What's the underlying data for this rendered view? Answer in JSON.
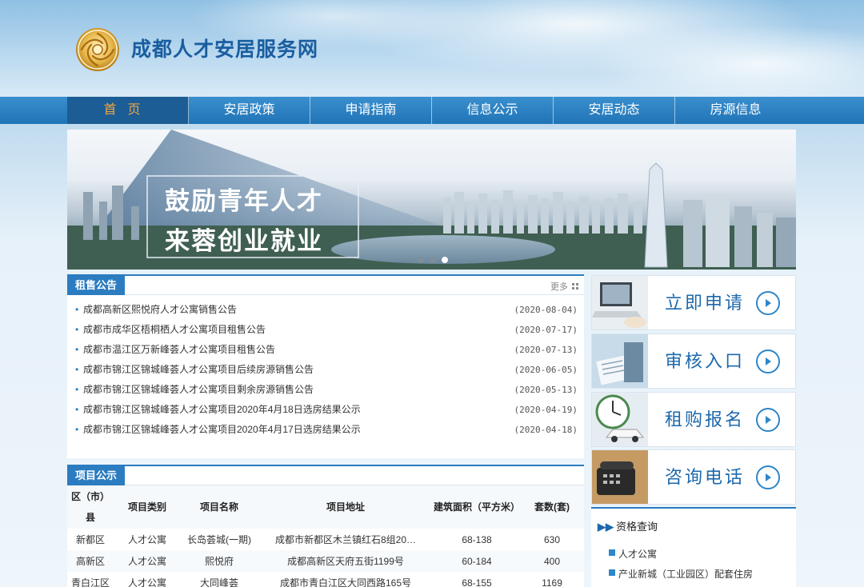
{
  "site": {
    "title": "成都人才安居服务网"
  },
  "nav": {
    "items": [
      "首页",
      "安居政策",
      "申请指南",
      "信息公示",
      "安居动态",
      "房源信息"
    ]
  },
  "banner": {
    "line1": "鼓励青年人才",
    "line2": "来蓉创业就业",
    "slide_count": 3,
    "active_slide": 3
  },
  "notices": {
    "title": "租售公告",
    "more": "更多",
    "items": [
      {
        "text": "成都高新区熙悦府人才公寓销售公告",
        "date": "(2020-08-04)"
      },
      {
        "text": "成都市成华区梧桐栖人才公寓项目租售公告",
        "date": "(2020-07-17)"
      },
      {
        "text": "成都市温江区万新峰荟人才公寓项目租售公告",
        "date": "(2020-07-13)"
      },
      {
        "text": "成都市锦江区锦城峰荟人才公寓项目后续房源销售公告",
        "date": "(2020-06-05)"
      },
      {
        "text": "成都市锦江区锦城峰荟人才公寓项目剩余房源销售公告",
        "date": "(2020-05-13)"
      },
      {
        "text": "成都市锦江区锦城峰荟人才公寓项目2020年4月18日选房结果公示",
        "date": "(2020-04-19)"
      },
      {
        "text": "成都市锦江区锦城峰荟人才公寓项目2020年4月17日选房结果公示",
        "date": "(2020-04-18)"
      }
    ]
  },
  "projects": {
    "title": "项目公示",
    "headers": {
      "district": "区（市）县",
      "type": "项目类别",
      "name": "项目名称",
      "address": "项目地址",
      "area": "建筑面积（平方米）",
      "units": "套数(套)"
    },
    "rows": [
      {
        "district": "新都区",
        "type": "人才公寓",
        "name": "长岛荟城(一期)",
        "address": "成都市新都区木兰镇红石8组20…",
        "area": "68-138",
        "units": "630"
      },
      {
        "district": "高新区",
        "type": "人才公寓",
        "name": "熙悦府",
        "address": "成都高新区天府五街1199号",
        "area": "60-184",
        "units": "400"
      },
      {
        "district": "青白江区",
        "type": "人才公寓",
        "name": "大同峰荟",
        "address": "成都市青白江区大同西路165号",
        "area": "68-155",
        "units": "1169"
      }
    ]
  },
  "side": {
    "buttons": [
      {
        "label": "立即申请"
      },
      {
        "label": "审核入口"
      },
      {
        "label": "租购报名"
      },
      {
        "label": "咨询电话"
      }
    ],
    "qualification": {
      "title": "资格查询",
      "links": [
        "人才公寓",
        "产业新城（工业园区）配套住房"
      ]
    }
  },
  "colors": {
    "primary": "#2b7cc0",
    "nav_active_text": "#f0a640",
    "title": "#1a5ea0"
  }
}
